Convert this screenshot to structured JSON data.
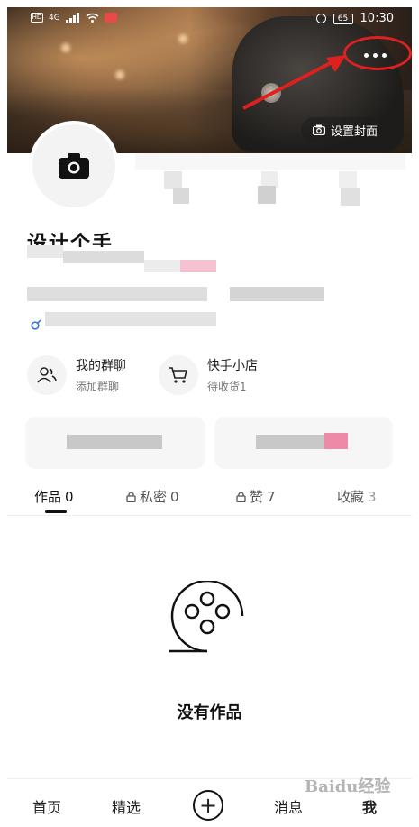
{
  "status_bar": {
    "network": "4G",
    "battery": "65",
    "time": "10:30"
  },
  "header": {
    "set_cover_label": "设置封面"
  },
  "profile": {
    "username": "设计个手"
  },
  "quick_entries": [
    {
      "title": "我的群聊",
      "subtitle": "添加群聊",
      "icon": "group-icon"
    },
    {
      "title": "快手小店",
      "subtitle": "待收货1",
      "icon": "cart-icon"
    }
  ],
  "tabs": [
    {
      "label": "作品",
      "count": "0",
      "locked": false,
      "active": true
    },
    {
      "label": "私密",
      "count": "0",
      "locked": true,
      "active": false
    },
    {
      "label": "赞",
      "count": "7",
      "locked": true,
      "active": false
    },
    {
      "label": "收藏",
      "count": "3",
      "locked": false,
      "active": false
    }
  ],
  "empty_state": {
    "title": "没有作品",
    "icon": "film-reel-icon"
  },
  "bottom_nav": {
    "home": "首页",
    "featured": "精选",
    "post": "+",
    "messages": "消息",
    "me": "我"
  },
  "watermark": "Baidu经验",
  "colors": {
    "annotation": "#e02020",
    "accent": "#111111",
    "mosaic_pink": "#f2a6bd"
  }
}
